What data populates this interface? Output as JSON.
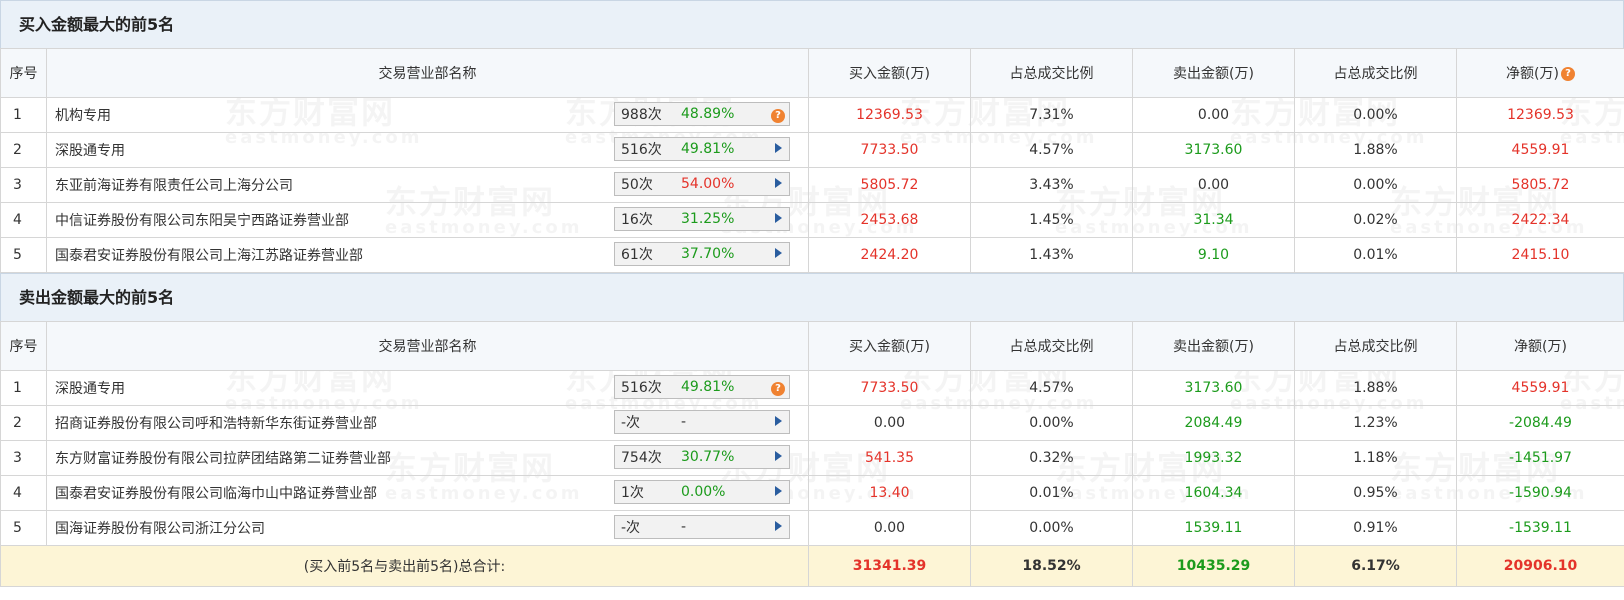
{
  "watermark": {
    "cn": "东方财富网",
    "en": "eastmoney.com"
  },
  "colors": {
    "up": "#e4332a",
    "down": "#1c9b1c",
    "header_bg": "#f5f8fb",
    "title_bg": "#eaf1f8",
    "total_bg": "#fdf5d6"
  },
  "buy": {
    "title": "买入金额最大的前5名",
    "headers": [
      "序号",
      "交易营业部名称",
      "买入金额(万)",
      "占总成交比例",
      "卖出金额(万)",
      "占总成交比例",
      "净额(万)"
    ],
    "rows": [
      {
        "seq": "1",
        "name": "机构专用",
        "count": "988次",
        "rate": "48.89%",
        "rate_color": "green",
        "icon": "help-icon",
        "buy": "12369.53",
        "buy_pct": "7.31%",
        "sell": "0.00",
        "sell_color": "black",
        "sell_pct": "0.00%",
        "net": "12369.53",
        "net_color": "red"
      },
      {
        "seq": "2",
        "name": "深股通专用",
        "count": "516次",
        "rate": "49.81%",
        "rate_color": "green",
        "icon": "play-icon",
        "buy": "7733.50",
        "buy_pct": "4.57%",
        "sell": "3173.60",
        "sell_color": "green",
        "sell_pct": "1.88%",
        "net": "4559.91",
        "net_color": "red"
      },
      {
        "seq": "3",
        "name": "东亚前海证券有限责任公司上海分公司",
        "count": "50次",
        "rate": "54.00%",
        "rate_color": "red",
        "icon": "play-icon",
        "buy": "5805.72",
        "buy_pct": "3.43%",
        "sell": "0.00",
        "sell_color": "black",
        "sell_pct": "0.00%",
        "net": "5805.72",
        "net_color": "red"
      },
      {
        "seq": "4",
        "name": "中信证券股份有限公司东阳吴宁西路证券营业部",
        "count": "16次",
        "rate": "31.25%",
        "rate_color": "green",
        "icon": "play-icon",
        "buy": "2453.68",
        "buy_pct": "1.45%",
        "sell": "31.34",
        "sell_color": "green",
        "sell_pct": "0.02%",
        "net": "2422.34",
        "net_color": "red"
      },
      {
        "seq": "5",
        "name": "国泰君安证券股份有限公司上海江苏路证券营业部",
        "count": "61次",
        "rate": "37.70%",
        "rate_color": "green",
        "icon": "play-icon",
        "buy": "2424.20",
        "buy_pct": "1.43%",
        "sell": "9.10",
        "sell_color": "green",
        "sell_pct": "0.01%",
        "net": "2415.10",
        "net_color": "red"
      }
    ]
  },
  "sell": {
    "title": "卖出金额最大的前5名",
    "headers": [
      "序号",
      "交易营业部名称",
      "买入金额(万)",
      "占总成交比例",
      "卖出金额(万)",
      "占总成交比例",
      "净额(万)"
    ],
    "rows": [
      {
        "seq": "1",
        "name": "深股通专用",
        "count": "516次",
        "rate": "49.81%",
        "rate_color": "green",
        "icon": "help-icon",
        "buy": "7733.50",
        "buy_color": "red",
        "buy_pct": "4.57%",
        "sell": "3173.60",
        "sell_pct": "1.88%",
        "net": "4559.91",
        "net_color": "red"
      },
      {
        "seq": "2",
        "name": "招商证券股份有限公司呼和浩特新华东街证券营业部",
        "count": "-次",
        "rate": "-",
        "rate_color": "black",
        "icon": "play-icon",
        "buy": "0.00",
        "buy_color": "black",
        "buy_pct": "0.00%",
        "sell": "2084.49",
        "sell_pct": "1.23%",
        "net": "-2084.49",
        "net_color": "green"
      },
      {
        "seq": "3",
        "name": "东方财富证券股份有限公司拉萨团结路第二证券营业部",
        "count": "754次",
        "rate": "30.77%",
        "rate_color": "green",
        "icon": "play-icon",
        "buy": "541.35",
        "buy_color": "red",
        "buy_pct": "0.32%",
        "sell": "1993.32",
        "sell_pct": "1.18%",
        "net": "-1451.97",
        "net_color": "green"
      },
      {
        "seq": "4",
        "name": "国泰君安证券股份有限公司临海巾山中路证券营业部",
        "count": "1次",
        "rate": "0.00%",
        "rate_color": "green",
        "icon": "play-icon",
        "buy": "13.40",
        "buy_color": "red",
        "buy_pct": "0.01%",
        "sell": "1604.34",
        "sell_pct": "0.95%",
        "net": "-1590.94",
        "net_color": "green"
      },
      {
        "seq": "5",
        "name": "国海证券股份有限公司浙江分公司",
        "count": "-次",
        "rate": "-",
        "rate_color": "black",
        "icon": "play-icon",
        "buy": "0.00",
        "buy_color": "black",
        "buy_pct": "0.00%",
        "sell": "1539.11",
        "sell_pct": "0.91%",
        "net": "-1539.11",
        "net_color": "green"
      }
    ]
  },
  "total": {
    "label": "(买入前5名与卖出前5名)总合计:",
    "buy": "31341.39",
    "buy_pct": "18.52%",
    "sell": "10435.29",
    "sell_pct": "6.17%",
    "net": "20906.10"
  }
}
